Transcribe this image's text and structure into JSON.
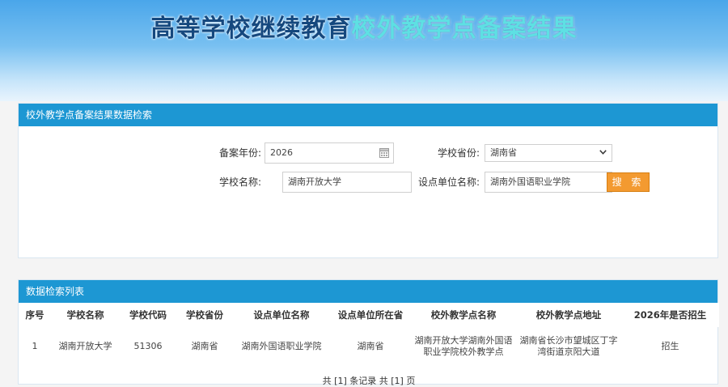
{
  "banner": {
    "title_dark": "高等学校继续教育",
    "title_light": "校外教学点备案结果"
  },
  "search_panel": {
    "heading": "校外教学点备案结果数据检索",
    "year_label": "备案年份:",
    "year_value": "2026",
    "province_label": "学校省份:",
    "province_value": "湖南省",
    "school_label": "学校名称:",
    "school_value": "湖南开放大学",
    "host_label": "设点单位名称:",
    "host_value": "湖南外国语职业学院",
    "search_button": "搜 索"
  },
  "result_panel": {
    "heading": "数据检索列表",
    "columns": [
      "序号",
      "学校名称",
      "学校代码",
      "学校省份",
      "设点单位名称",
      "设点单位所在省",
      "校外教学点名称",
      "校外教学点地址",
      "2026年是否招生"
    ],
    "rows": [
      {
        "no": "1",
        "school": "湖南开放大学",
        "code": "51306",
        "province": "湖南省",
        "host": "湖南外国语职业学院",
        "host_province": "湖南省",
        "site_name": "湖南开放大学湖南外国语职业学院校外教学点",
        "site_address": "湖南省长沙市望城区丁字湾街道京阳大道",
        "enrolling": "招生"
      }
    ],
    "pager": "共 [1] 条记录 共 [1] 页"
  }
}
